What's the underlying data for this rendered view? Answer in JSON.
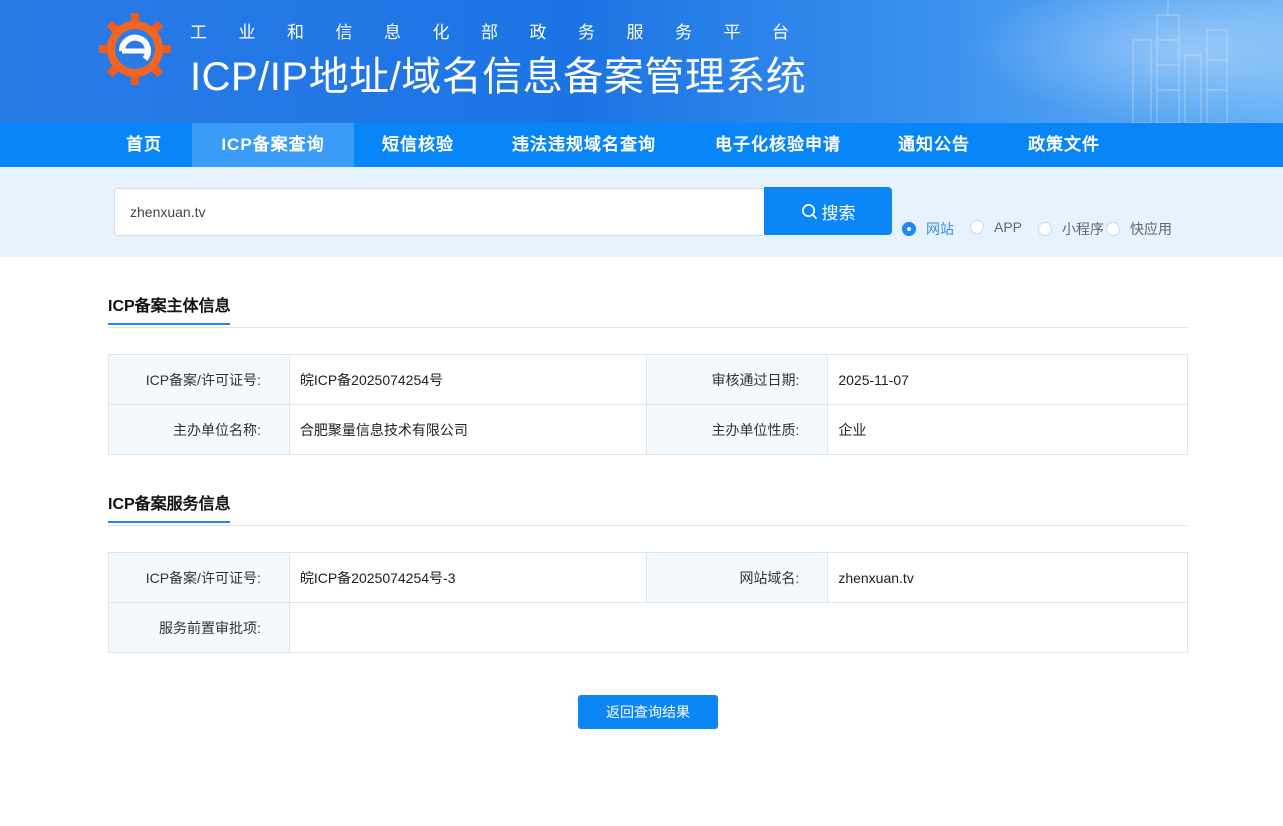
{
  "header": {
    "subtitle": "工业和信息化部政务服务平台",
    "title": "ICP/IP地址/域名信息备案管理系统"
  },
  "nav": {
    "items": [
      "首页",
      "ICP备案查询",
      "短信核验",
      "违法违规域名查询",
      "电子化核验申请",
      "通知公告",
      "政策文件"
    ],
    "active": "ICP备案查询"
  },
  "search": {
    "value": "zhenxuan.tv",
    "button_label": "搜索",
    "types": [
      "网站",
      "APP",
      "小程序",
      "快应用"
    ],
    "selected_type": "网站"
  },
  "subject_section": {
    "title": "ICP备案主体信息",
    "rows": [
      [
        {
          "label": "ICP备案/许可证号:",
          "value": "皖ICP备2025074254号"
        },
        {
          "label": "审核通过日期:",
          "value": "2025-11-07"
        }
      ],
      [
        {
          "label": "主办单位名称:",
          "value": "合肥聚量信息技术有限公司"
        },
        {
          "label": "主办单位性质:",
          "value": "企业"
        }
      ]
    ]
  },
  "service_section": {
    "title": "ICP备案服务信息",
    "license_label": "ICP备案/许可证号:",
    "license_value": "皖ICP备2025074254号-3",
    "domain_label": "网站域名:",
    "domain_value": "zhenxuan.tv",
    "approval_label": "服务前置审批项:",
    "approval_value": ""
  },
  "back_button": "返回查询结果",
  "colors": {
    "primary": "#0b86f7",
    "nav_active": "#3b9cf8",
    "search_band": "#e6f2fd"
  }
}
